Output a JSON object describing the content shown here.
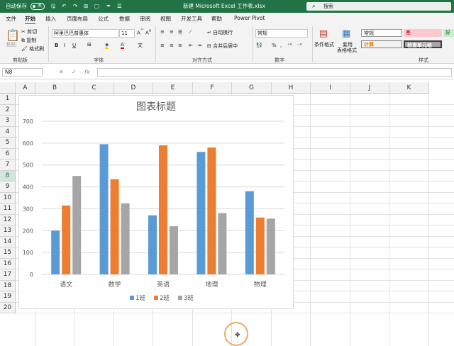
{
  "titlebar": {
    "autosave": "自动保存",
    "toggle_state": "关",
    "title": "新建 Microsoft Excel 工作表.xlsx",
    "search": "搜索"
  },
  "menu": [
    "文件",
    "开始",
    "插入",
    "页面布局",
    "公式",
    "数据",
    "审阅",
    "视图",
    "开发工具",
    "帮助",
    "Power Pivot"
  ],
  "ribbon": {
    "clipboard": {
      "paste": "粘贴",
      "cut": "剪切",
      "copy": "复制",
      "format_painter": "格式刷",
      "group": "剪贴板"
    },
    "font": {
      "name": "阿里巴巴普惠体",
      "size": "11",
      "bold": "B",
      "italic": "I",
      "underline": "U",
      "group": "字体"
    },
    "alignment": {
      "wrap": "自动换行",
      "merge": "合并后居中",
      "group": "对齐方式"
    },
    "number": {
      "format": "常规",
      "group": "数字"
    },
    "styles": {
      "conditional": "条件格式",
      "table_line1": "套用",
      "table_line2": "表格格式",
      "normal": "常规",
      "bad": "差",
      "good": "好",
      "calc": "计算",
      "check": "检查单元格",
      "group": "样式"
    }
  },
  "formula_bar": {
    "name_box": "N8",
    "cancel": "✕",
    "enter": "✓",
    "fx": "fx",
    "value": ""
  },
  "columns": [
    "A",
    "B",
    "C",
    "D",
    "E",
    "F",
    "G",
    "H",
    "I",
    "J",
    "K"
  ],
  "rows": [
    "1",
    "2",
    "3",
    "4",
    "5",
    "6",
    "7",
    "8",
    "9",
    "10",
    "11",
    "12",
    "13",
    "14",
    "15",
    "16",
    "17",
    "18",
    "19",
    "20"
  ],
  "selected_row": "8",
  "chart_data": {
    "type": "bar",
    "title": "图表标题",
    "categories": [
      "语文",
      "数学",
      "英语",
      "地理",
      "物理"
    ],
    "series": [
      {
        "name": "1班",
        "color": "#5b9bd5",
        "values": [
          200,
          595,
          270,
          560,
          380
        ]
      },
      {
        "name": "2班",
        "color": "#ed7d31",
        "values": [
          315,
          435,
          590,
          580,
          260
        ]
      },
      {
        "name": "3班",
        "color": "#a5a5a5",
        "values": [
          450,
          325,
          220,
          280,
          255
        ]
      }
    ],
    "ylim": [
      0,
      700
    ],
    "yticks": [
      0,
      100,
      200,
      300,
      400,
      500,
      600,
      700
    ],
    "grid": true,
    "legend": "bottom"
  }
}
